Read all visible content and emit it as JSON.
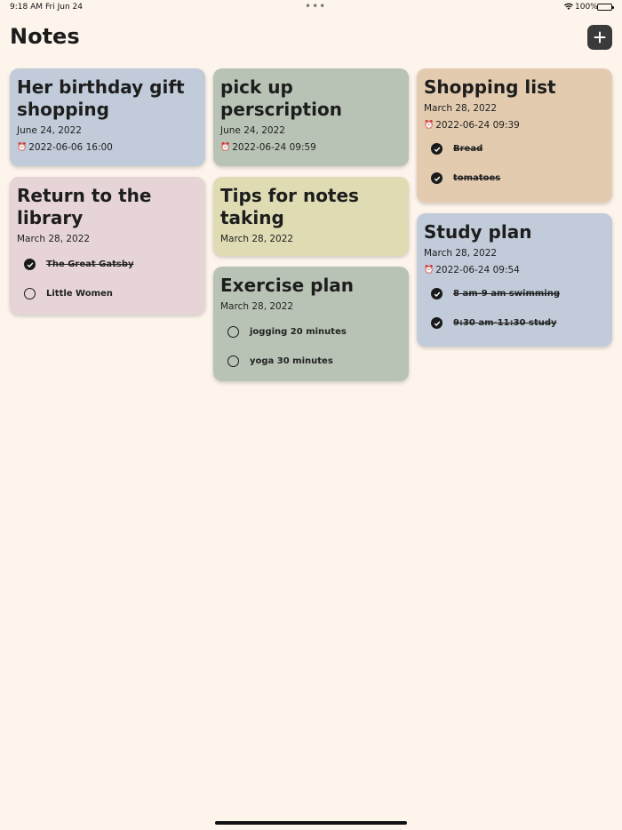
{
  "status": {
    "time": "9:18 AM",
    "date": "Fri Jun 24",
    "battery": "100%"
  },
  "header": {
    "title": "Notes"
  },
  "colors": {
    "blue": "#c1cbd9",
    "green": "#b9c3b5",
    "tan": "#e3cbaf",
    "pink": "#e6d4d7",
    "yellow": "#dfdcb3",
    "background": "#fdf5ec"
  },
  "notes": [
    {
      "title": "Her birthday gift shopping",
      "date": "June 24, 2022",
      "reminder": "2022-06-06 16:00"
    },
    {
      "title": "Return to the library",
      "date": "March 28, 2022",
      "items": [
        {
          "text": "The Great  Gatsby",
          "done": true
        },
        {
          "text": "Little Women",
          "done": false
        }
      ]
    },
    {
      "title": "pick up perscription",
      "date": "June 24, 2022",
      "reminder": "2022-06-24 09:59"
    },
    {
      "title": "Tips for notes taking",
      "date": "March 28, 2022"
    },
    {
      "title": "Exercise plan",
      "date": "March 28, 2022",
      "items": [
        {
          "text": "jogging 20 minutes",
          "done": false
        },
        {
          "text": "yoga 30 minutes",
          "done": false
        }
      ]
    },
    {
      "title": "Shopping list",
      "date": "March 28, 2022",
      "reminder": "2022-06-24 09:39",
      "items": [
        {
          "text": "Bread",
          "done": true
        },
        {
          "text": "tomatoes",
          "done": true
        }
      ]
    },
    {
      "title": "Study plan",
      "date": "March 28, 2022",
      "reminder": "2022-06-24 09:54",
      "items": [
        {
          "text": "8 am-9 am swimming",
          "done": true
        },
        {
          "text": "9:30 am-11:30 study",
          "done": true
        }
      ]
    }
  ]
}
